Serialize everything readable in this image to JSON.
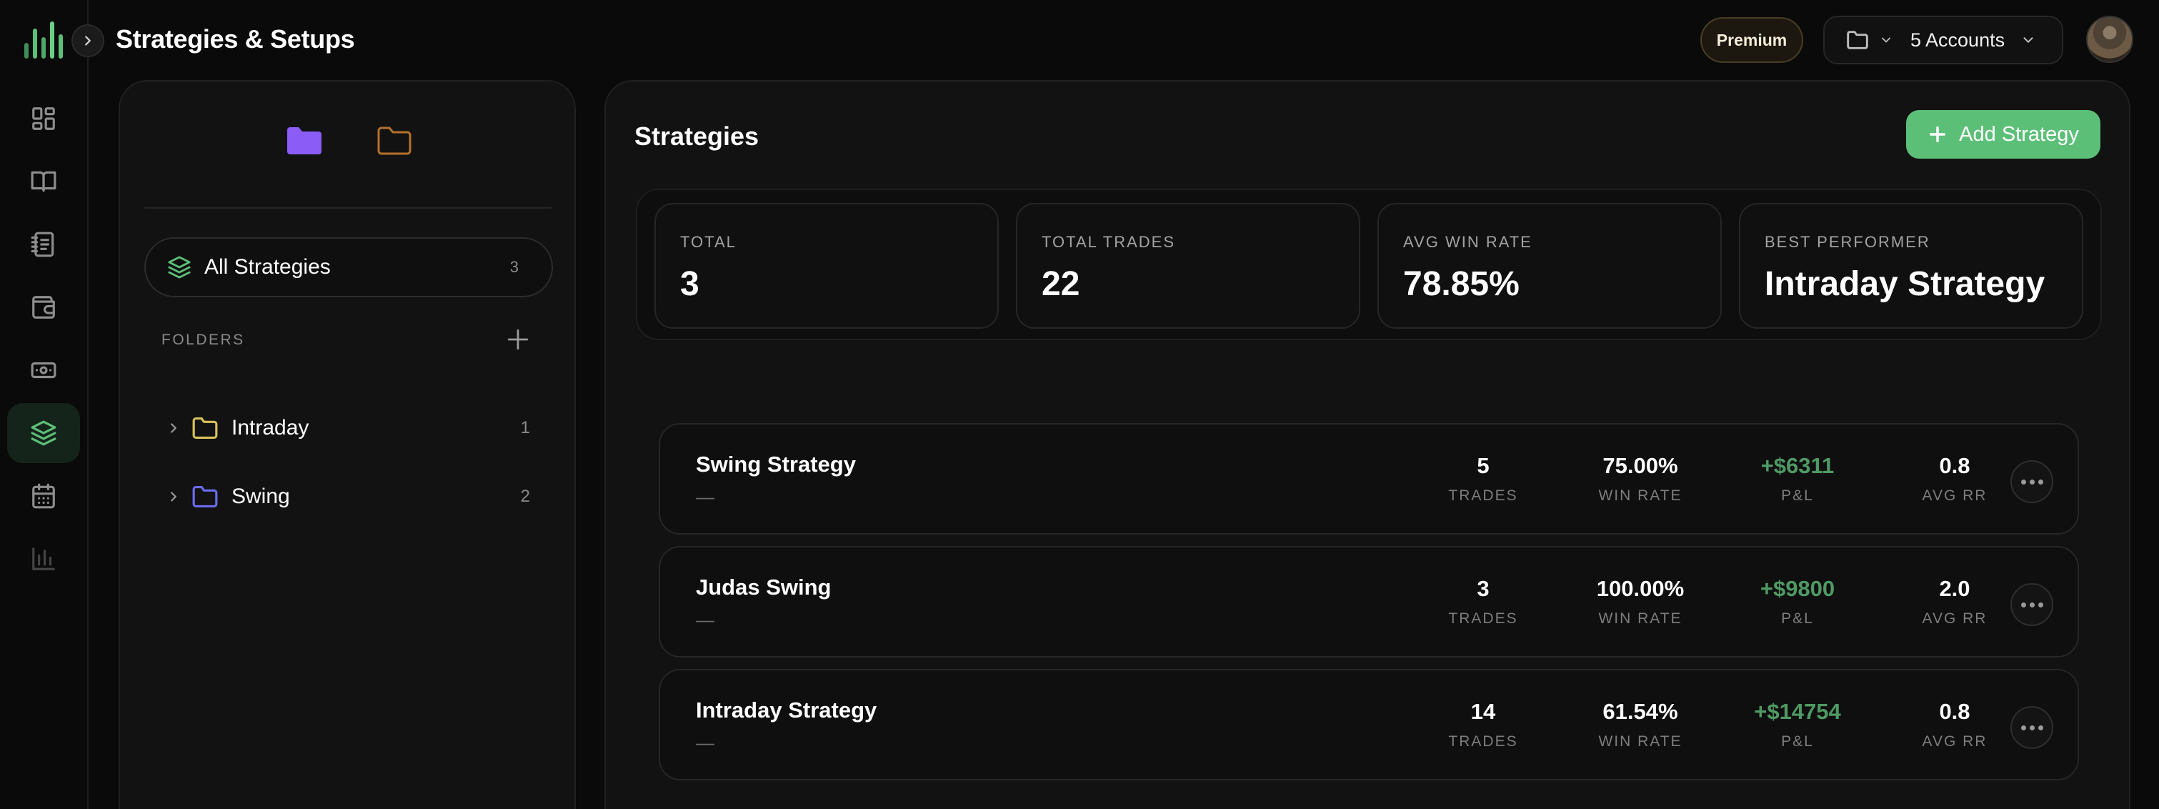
{
  "header": {
    "title": "Strategies & Setups",
    "premium_label": "Premium",
    "accounts_label": "5 Accounts"
  },
  "sidebar": {
    "items": [
      {
        "name": "dashboard",
        "icon": "dashboard-icon"
      },
      {
        "name": "journal",
        "icon": "book-icon"
      },
      {
        "name": "notebook",
        "icon": "notebook-icon"
      },
      {
        "name": "wallet",
        "icon": "wallet-icon"
      },
      {
        "name": "cash",
        "icon": "cash-icon"
      },
      {
        "name": "strategies",
        "icon": "layers-icon",
        "active": true
      },
      {
        "name": "calendar",
        "icon": "calendar-icon"
      },
      {
        "name": "reports",
        "icon": "bar-chart-icon"
      }
    ]
  },
  "folders_panel": {
    "all_label": "All Strategies",
    "all_count": "3",
    "folders_heading": "FOLDERS",
    "folders": [
      {
        "name": "Intraday",
        "count": "1",
        "color": "#d8c25a"
      },
      {
        "name": "Swing",
        "count": "2",
        "color": "#6b6cf0"
      }
    ]
  },
  "main": {
    "title": "Strategies",
    "add_label": "Add Strategy",
    "stats": [
      {
        "label": "TOTAL",
        "value": "3"
      },
      {
        "label": "TOTAL TRADES",
        "value": "22"
      },
      {
        "label": "AVG WIN RATE",
        "value": "78.85%"
      },
      {
        "label": "BEST PERFORMER",
        "value": "Intraday Strategy"
      }
    ],
    "metric_labels": {
      "trades": "TRADES",
      "win_rate": "WIN RATE",
      "pnl": "P&L",
      "avg_rr": "AVG RR"
    },
    "strategies": [
      {
        "name": "Swing Strategy",
        "desc": "—",
        "trades": "5",
        "win_rate": "75.00%",
        "pnl": "+$6311",
        "avg_rr": "0.8"
      },
      {
        "name": "Judas Swing",
        "desc": "—",
        "trades": "3",
        "win_rate": "100.00%",
        "pnl": "+$9800",
        "avg_rr": "2.0"
      },
      {
        "name": "Intraday Strategy",
        "desc": "—",
        "trades": "14",
        "win_rate": "61.54%",
        "pnl": "+$14754",
        "avg_rr": "0.8"
      }
    ]
  },
  "colors": {
    "accent": "#5cbf78",
    "positive": "#4f9a64",
    "folder_purple": "#8b5cf6",
    "folder_orange": "#b5702a"
  }
}
